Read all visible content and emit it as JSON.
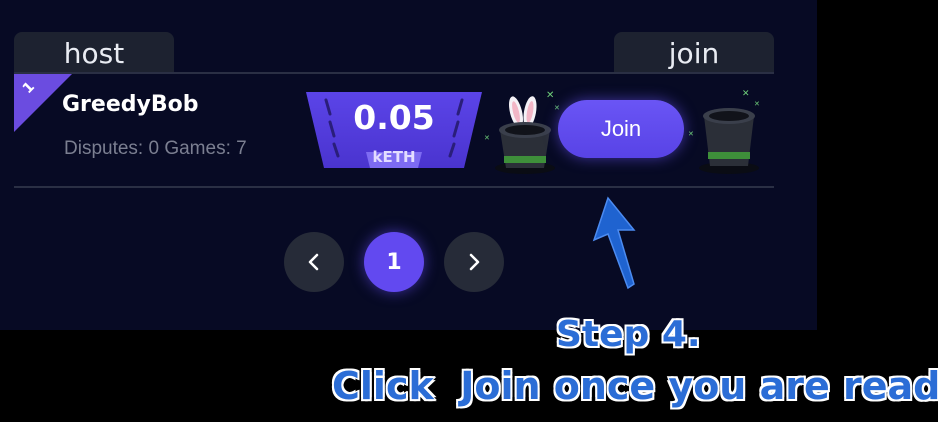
{
  "tabs": {
    "host_label": "host",
    "join_label": "join"
  },
  "game_row": {
    "rank": "1",
    "player_name": "GreedyBob",
    "stats": "Disputes: 0 Games: 7",
    "amount": "0.05",
    "currency": "kETH",
    "join_label": "Join"
  },
  "pagination": {
    "current_page": "1"
  },
  "tutorial": {
    "step_label": "Step 4.",
    "instruction": "Click  Join once you are ready"
  },
  "colors": {
    "accent": "#6249f0",
    "panel_bg": "#070a24",
    "tab_bg": "#1d2230",
    "caption": "#2b6dd6"
  },
  "icons": {
    "prev": "chevron-left-icon",
    "next": "chevron-right-icon",
    "host_hat": "magic-hat-rabbit-icon",
    "empty_hat": "magic-hat-icon",
    "pointer": "arrow-up-icon"
  }
}
